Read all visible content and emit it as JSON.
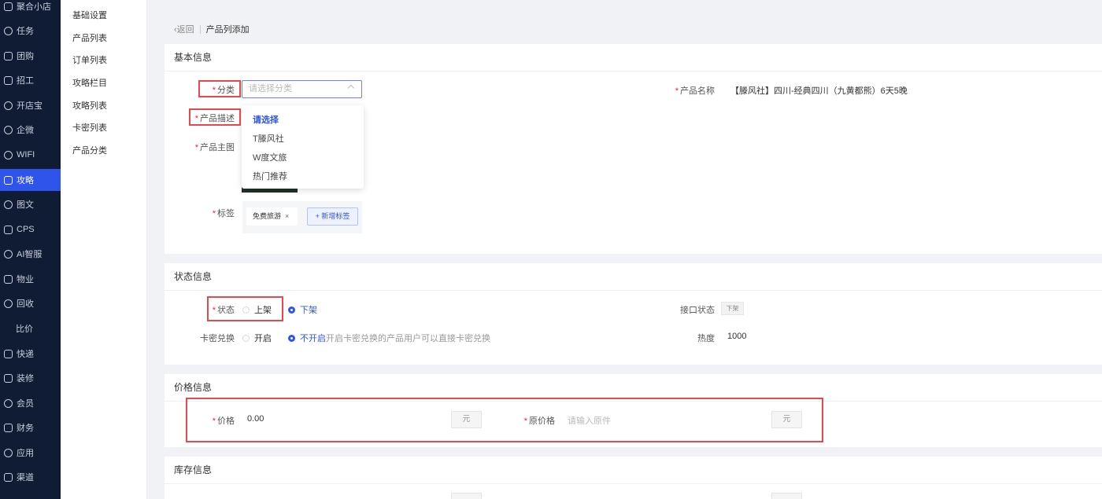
{
  "nav": {
    "items": [
      {
        "label": "聚合小店"
      },
      {
        "label": "任务"
      },
      {
        "label": "团购"
      },
      {
        "label": "招工"
      },
      {
        "label": "开店宝"
      },
      {
        "label": "企微"
      },
      {
        "label": "WIFI"
      },
      {
        "label": "攻略"
      },
      {
        "label": "图文"
      },
      {
        "label": "CPS"
      },
      {
        "label": "AI智服"
      },
      {
        "label": "物业"
      },
      {
        "label": "回收"
      },
      {
        "label": "比价"
      },
      {
        "label": "快递"
      },
      {
        "label": "装修"
      },
      {
        "label": "会员"
      },
      {
        "label": "财务"
      },
      {
        "label": "应用"
      },
      {
        "label": "渠道"
      }
    ]
  },
  "submenu": [
    "基础设置",
    "产品列表",
    "订单列表",
    "攻略栏目",
    "攻略列表",
    "卡密列表",
    "产品分类"
  ],
  "breadcrumb": {
    "back": "返回",
    "title": "产品列添加"
  },
  "basic": {
    "header": "基本信息",
    "category_label": "分类",
    "category_placeholder": "请选择分类",
    "category_options": [
      "请选择",
      "T滕风社",
      "W度文旅",
      "热门推荐"
    ],
    "desc_label": "产品描述",
    "image_label": "产品主图",
    "name_label": "产品名称",
    "name_value": "【滕风社】四川-经典四川（九黄都熊）6天5晚",
    "tags_label": "标签",
    "tag": "免费旅游",
    "tag_remove": "×",
    "add_tag": "+ 新增标签"
  },
  "status": {
    "header": "状态信息",
    "status_label": "状态",
    "on_shelf": "上架",
    "off_shelf": "下架",
    "card_label": "卡密兑换",
    "enable": "开启",
    "disable": "不开启",
    "disable_hint": "开启卡密兑换的产品用户可以直接卡密兑换",
    "api_label": "接口状态",
    "api_value": "下架",
    "heat_label": "热度",
    "heat_value": "1000"
  },
  "price": {
    "header": "价格信息",
    "price_label": "价格",
    "price_value": "0.00",
    "unit": "元",
    "orig_label": "原价格",
    "orig_placeholder": "请输入原件"
  },
  "stock": {
    "header": "库存信息"
  },
  "colors": {
    "accent": "#2f54eb",
    "nav_bg": "#0f1c33",
    "highlight": "#e5484d",
    "required": "#f5222d"
  }
}
